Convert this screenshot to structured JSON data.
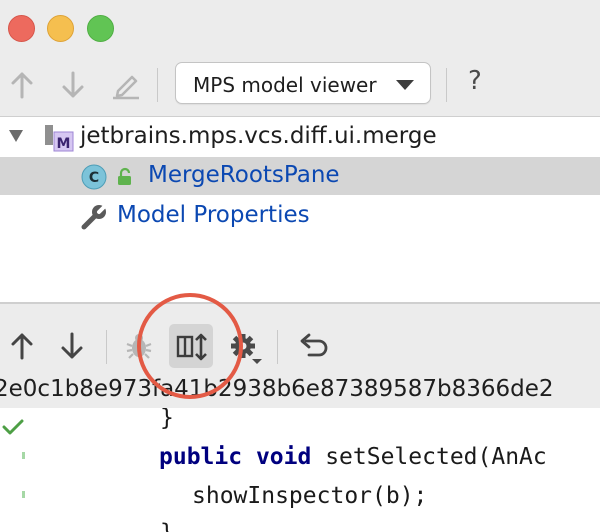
{
  "toolbar": {
    "view_selector": "MPS model viewer",
    "help_label": "?"
  },
  "tree": {
    "root_label": "jetbrains.mps.vcs.diff.ui.merge",
    "root_badge": "M",
    "class_label": "MergeRootsPane",
    "class_badge": "C",
    "props_label": "Model Properties"
  },
  "revision": {
    "hash": "2e0c1b8e973fa41b2938b6e87389587b8366de2"
  },
  "code": {
    "line1": "}",
    "line2_kw1": "public",
    "line2_kw2": "void",
    "line2_rest": " setSelected(AnAc",
    "line3": "showInspector(b);",
    "line4": "}"
  },
  "colors": {
    "accent_link": "#0b48b2",
    "annotation_circle": "#e35a45",
    "selection": "#d5d5d5"
  }
}
